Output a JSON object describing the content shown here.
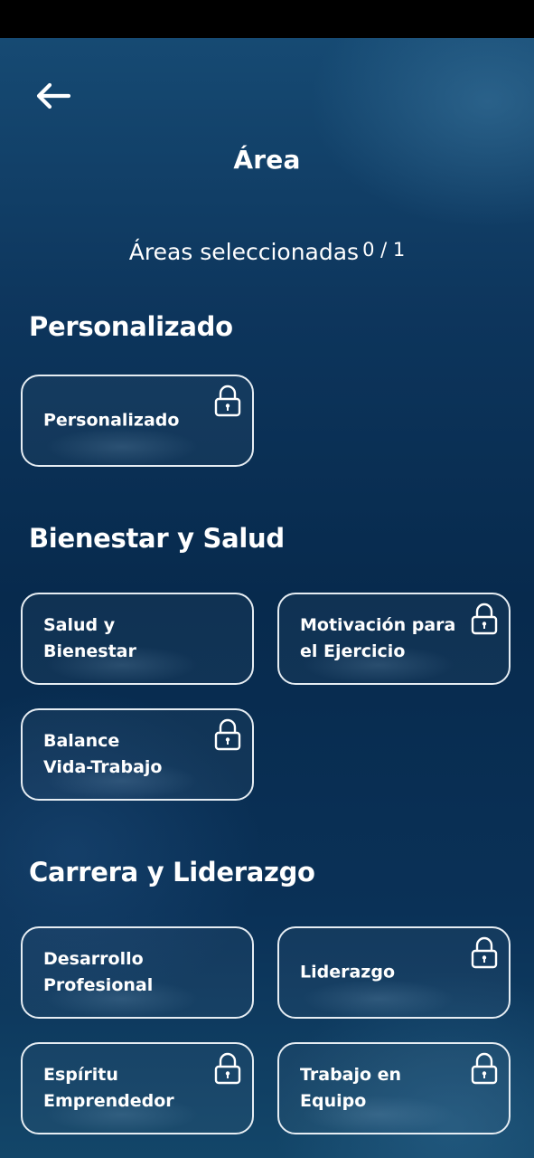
{
  "header": {
    "title": "Área",
    "back_icon": "arrow-left-icon"
  },
  "selection": {
    "label": "Áreas seleccionadas",
    "count": "0 / 1"
  },
  "sections": [
    {
      "title": "Personalizado",
      "cards": [
        {
          "label": "Personalizado",
          "locked": true
        }
      ]
    },
    {
      "title": "Bienestar y Salud",
      "cards": [
        {
          "label": "Salud y Bienestar",
          "locked": false
        },
        {
          "label": "Motivación para\nel Ejercicio",
          "locked": true
        },
        {
          "label": "Balance\nVida-Trabajo",
          "locked": true
        }
      ]
    },
    {
      "title": "Carrera y Liderazgo",
      "cards": [
        {
          "label": "Desarrollo\nProfesional",
          "locked": false
        },
        {
          "label": "Liderazgo",
          "locked": true
        },
        {
          "label": "Espíritu\nEmprendedor",
          "locked": true
        },
        {
          "label": "Trabajo en Equipo",
          "locked": true
        }
      ]
    }
  ],
  "colors": {
    "background_top": "#164a73",
    "background_mid": "#072a4d",
    "card_border": "#e6edf3",
    "text": "#ffffff",
    "status_bar": "#000000"
  },
  "icons": {
    "locked": "padlock-icon"
  }
}
